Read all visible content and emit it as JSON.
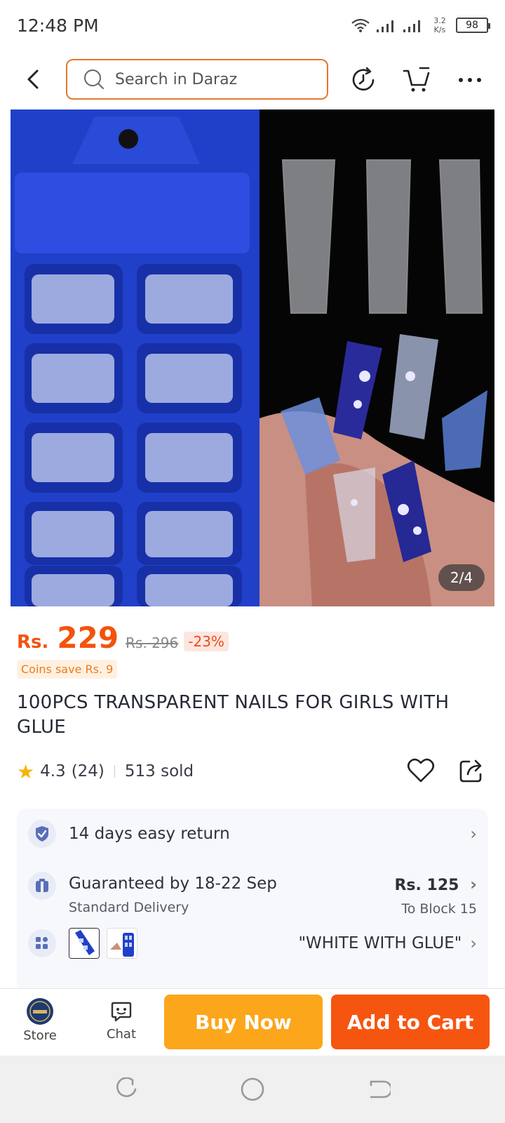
{
  "status_bar": {
    "time": "12:48 PM",
    "net_speed_value": "3.2",
    "net_speed_unit": "K/s",
    "battery": "98"
  },
  "nav": {
    "search_placeholder": "Search in Daraz",
    "icons": [
      "back-arrow-icon",
      "search-icon",
      "history-icon",
      "cart-icon",
      "more-icon"
    ]
  },
  "product_image": {
    "counter": "2/4"
  },
  "price": {
    "currency": "Rs.",
    "value": "229",
    "original": "Rs. 296",
    "discount": "-23%",
    "coins": "Coins save Rs. 9"
  },
  "product": {
    "title": "100PCS TRANSPARENT NAILS FOR GIRLS WITH GLUE",
    "rating": "4.3",
    "reviews": "(24)",
    "sold": "513 sold"
  },
  "info": {
    "returns": "14 days easy return",
    "delivery_title": "Guaranteed by 18-22 Sep",
    "delivery_type": "Standard Delivery",
    "delivery_fee": "Rs. 125",
    "delivery_location": "To Block 15",
    "variant_selected": "\"WHITE WITH GLUE\""
  },
  "action_bar": {
    "store": "Store",
    "chat": "Chat",
    "buy_now": "Buy Now",
    "add_to_cart": "Add to Cart"
  },
  "colors": {
    "brand_orange": "#f65510",
    "buy_now_orange": "#fca61b",
    "price_orange": "#f3530e",
    "search_border": "#e4782d",
    "product_box_blue": "#2942d6"
  }
}
